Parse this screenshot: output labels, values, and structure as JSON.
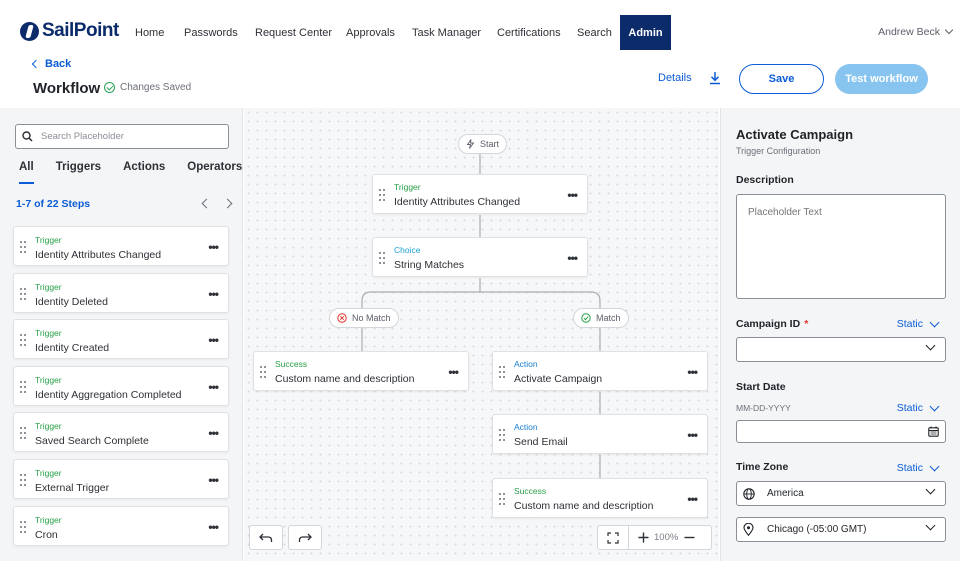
{
  "brand": {
    "name": "SailPoint"
  },
  "nav": {
    "items": [
      "Home",
      "Passwords",
      "Request Center",
      "Approvals",
      "Task Manager",
      "Certifications",
      "Search",
      "Admin"
    ],
    "active": "Admin",
    "user": "Andrew Beck"
  },
  "header": {
    "back": "Back",
    "title": "Workflow",
    "status": "Changes Saved",
    "details": "Details",
    "save": "Save",
    "test": "Test workflow"
  },
  "library": {
    "search_placeholder": "Search Placeholder",
    "tabs": [
      "All",
      "Triggers",
      "Actions",
      "Operators"
    ],
    "active_tab": "All",
    "pager": "1-7 of 22 Steps",
    "steps": [
      {
        "type": "Trigger",
        "name": "Identity Attributes Changed"
      },
      {
        "type": "Trigger",
        "name": "Identity Deleted"
      },
      {
        "type": "Trigger",
        "name": "Identity Created"
      },
      {
        "type": "Trigger",
        "name": "Identity Aggregation Completed"
      },
      {
        "type": "Trigger",
        "name": "Saved Search Complete"
      },
      {
        "type": "Trigger",
        "name": "External Trigger"
      },
      {
        "type": "Trigger",
        "name": "Cron"
      }
    ]
  },
  "canvas": {
    "start": "Start",
    "nodes": {
      "trigger": {
        "type": "Trigger",
        "name": "Identity Attributes Changed"
      },
      "choice": {
        "type": "Choice",
        "name": "String Matches"
      },
      "success_left": {
        "type": "Success",
        "name": "Custom name and description"
      },
      "action1": {
        "type": "Action",
        "name": "Activate Campaign"
      },
      "action2": {
        "type": "Action",
        "name": "Send Email"
      },
      "success_right": {
        "type": "Success",
        "name": "Custom name and description"
      }
    },
    "no_match": "No Match",
    "match": "Match",
    "zoom": "100%",
    "colors": {
      "trigger": "#27a048",
      "choice": "#1a9fd6",
      "action": "#1a7fd6",
      "success": "#27a048"
    }
  },
  "config": {
    "title": "Activate Campaign",
    "subtitle": "Trigger Configuration",
    "description_label": "Description",
    "description_placeholder": "Placeholder Text",
    "campaign_label": "Campaign ID",
    "campaign_required": "*",
    "static": "Static",
    "start_date_label": "Start Date",
    "start_date_hint": "MM-DD-YYYY",
    "timezone_label": "Time Zone",
    "region": "America",
    "city": "Chicago (-05:00 GMT)"
  }
}
